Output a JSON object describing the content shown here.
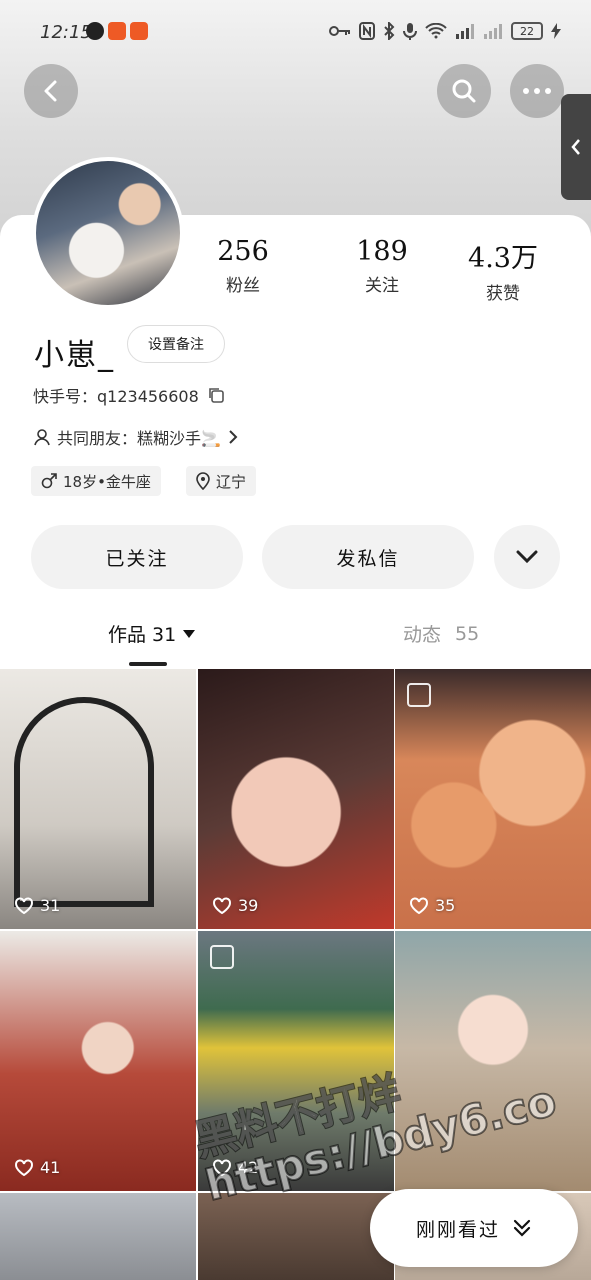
{
  "status_bar": {
    "time": "12:15",
    "battery": "22"
  },
  "profile": {
    "name": "小崽_",
    "remark_label": "设置备注",
    "kuaishou_id": "快手号：q123456608",
    "mutual_friends": "共同朋友：糕糊沙手🚬",
    "tags": [
      "18岁•金牛座",
      "辽宁"
    ]
  },
  "stats": [
    {
      "value": "256",
      "label": "粉丝"
    },
    {
      "value": "189",
      "label": "关注"
    },
    {
      "value": "4.3万",
      "label": "获赞"
    }
  ],
  "actions": {
    "followed": "已关注",
    "message": "发私信"
  },
  "tabs": {
    "works": "作品 31",
    "moments": "动态",
    "moments_count": "55"
  },
  "posts": [
    {
      "likes": "31",
      "color": "#d9d6d2"
    },
    {
      "likes": "39",
      "color": "#5b3b36"
    },
    {
      "likes": "35",
      "color": "#d8875a"
    },
    {
      "likes": "41",
      "color": "#b64a3a"
    },
    {
      "likes": "42",
      "color": "#6f7b6b"
    },
    {
      "likes": "",
      "color": "#c7b8a6"
    },
    {
      "likes": "",
      "color": "#8b8e93"
    },
    {
      "likes": "",
      "color": "#7b6253"
    }
  ],
  "watermark": "黑料不打烊\nhttps://bdy6.co",
  "recent_button": "刚刚看过"
}
